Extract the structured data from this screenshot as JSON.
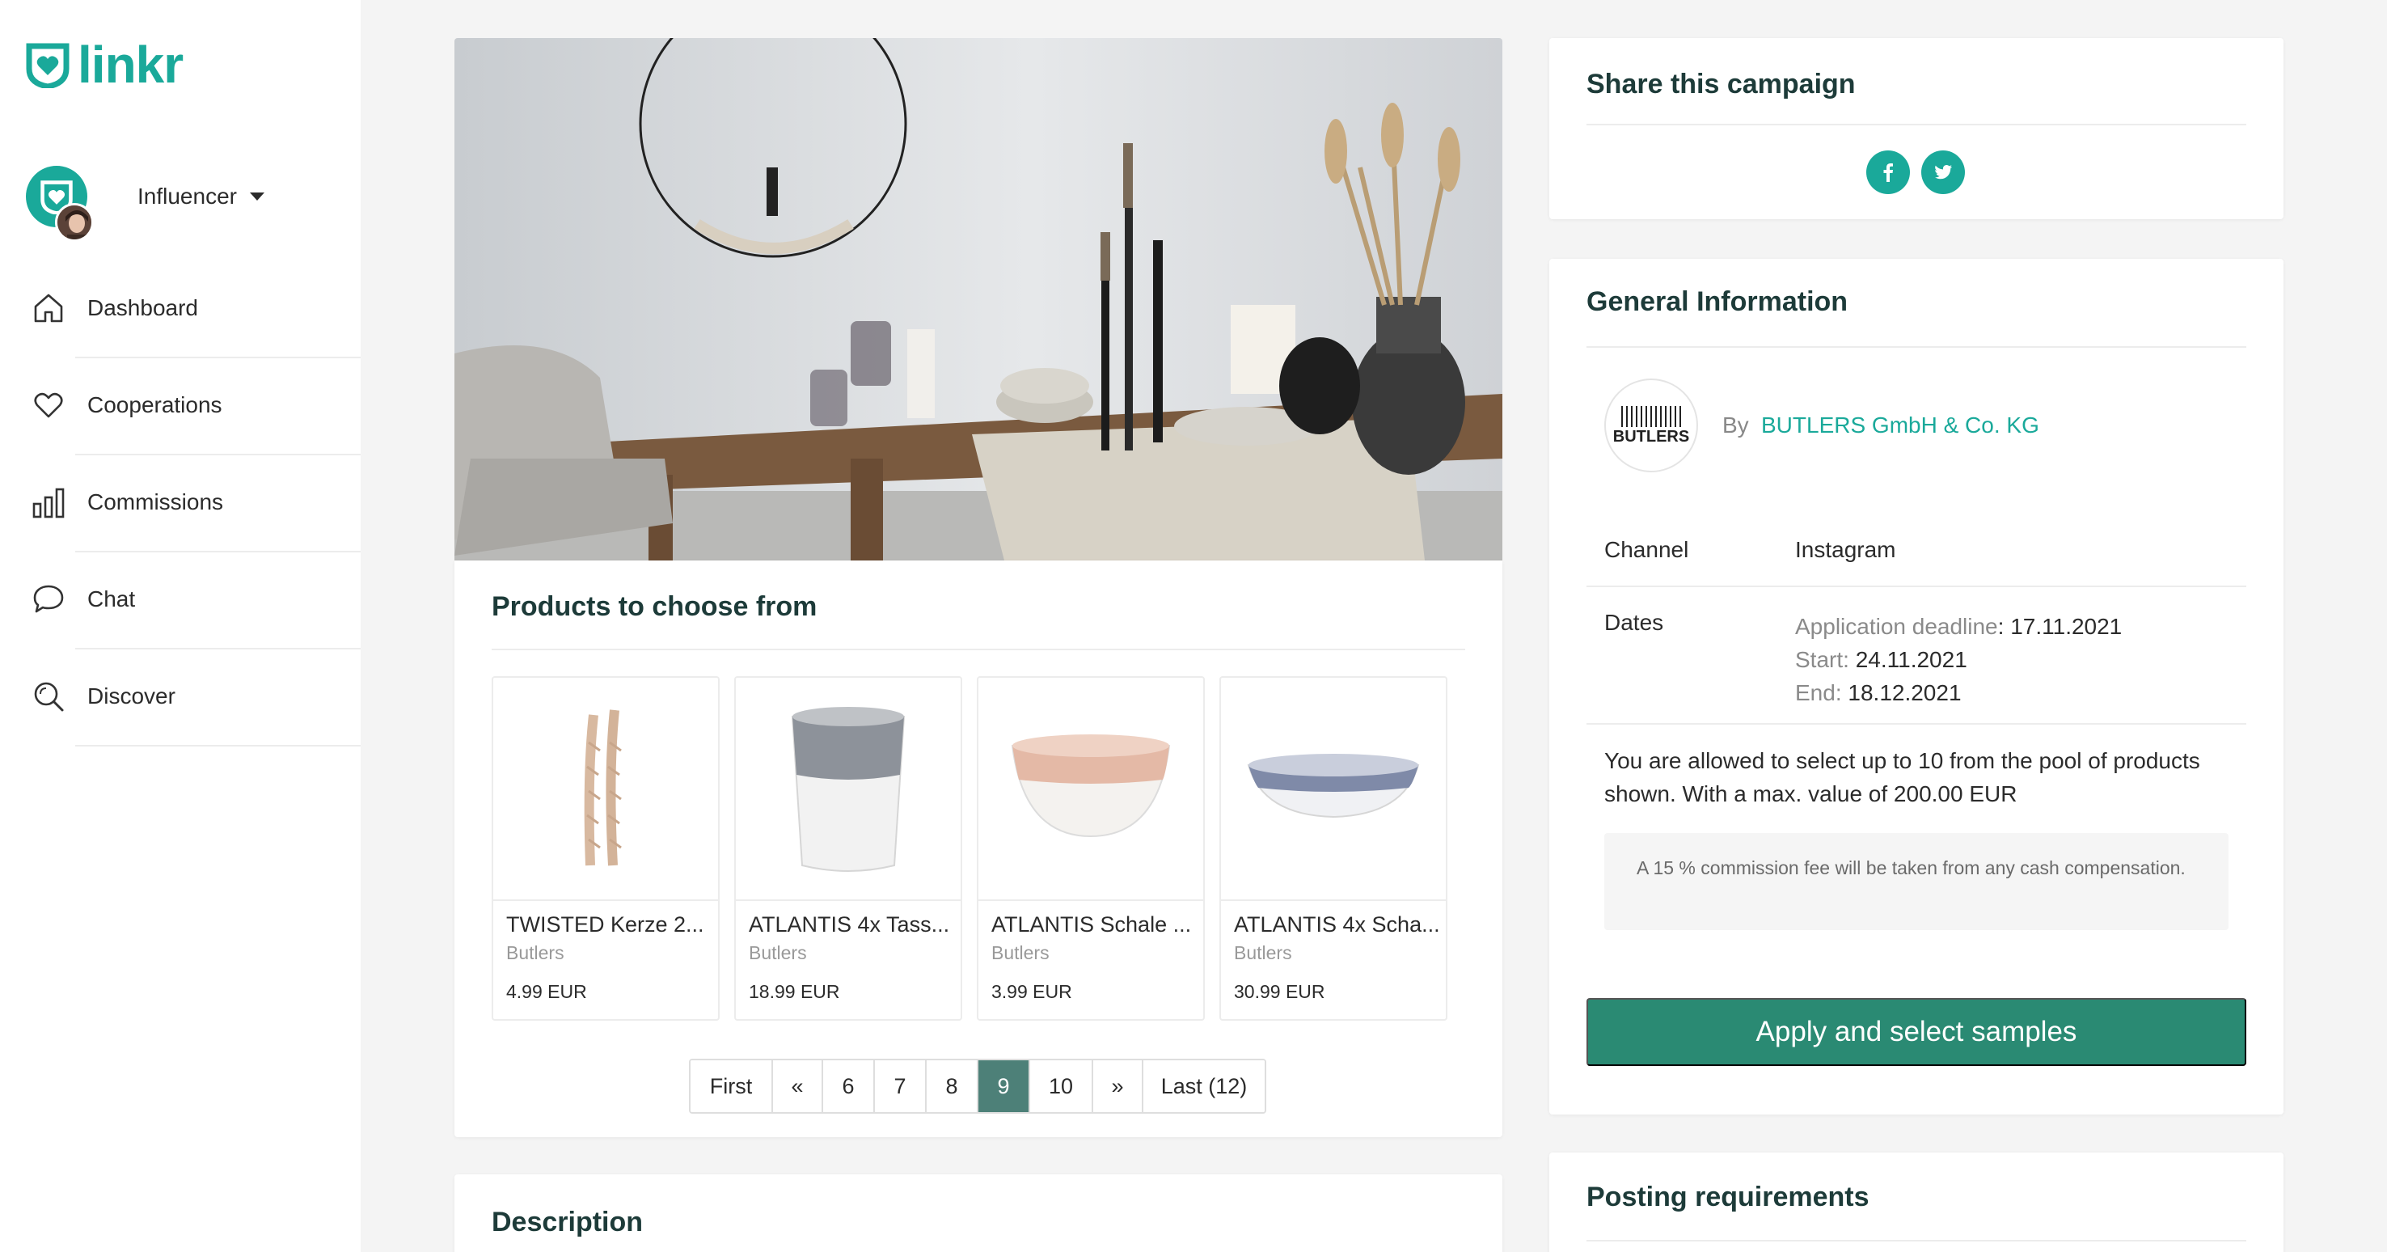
{
  "app": {
    "logo_text": "linkr"
  },
  "user": {
    "role": "Influencer"
  },
  "nav": [
    {
      "label": "Dashboard",
      "icon": "home-icon"
    },
    {
      "label": "Cooperations",
      "icon": "heart-icon"
    },
    {
      "label": "Commissions",
      "icon": "bar-chart-icon"
    },
    {
      "label": "Chat",
      "icon": "chat-bubble-icon"
    },
    {
      "label": "Discover",
      "icon": "search-icon"
    }
  ],
  "products_section": {
    "title": "Products to choose from",
    "items": [
      {
        "name": "TWISTED Kerze 2...",
        "brand": "Butlers",
        "price": "4.99 EUR"
      },
      {
        "name": "ATLANTIS 4x Tass...",
        "brand": "Butlers",
        "price": "18.99 EUR"
      },
      {
        "name": "ATLANTIS Schale ...",
        "brand": "Butlers",
        "price": "3.99 EUR"
      },
      {
        "name": "ATLANTIS 4x Scha...",
        "brand": "Butlers",
        "price": "30.99 EUR"
      }
    ],
    "pagination": {
      "first": "First",
      "prev": "«",
      "pages": [
        "6",
        "7",
        "8",
        "9",
        "10"
      ],
      "active": "9",
      "next": "»",
      "last": "Last (12)"
    }
  },
  "description": {
    "title": "Description"
  },
  "share": {
    "title": "Share this campaign",
    "networks": [
      "facebook-icon",
      "twitter-icon"
    ]
  },
  "general": {
    "title": "General Information",
    "by_label": "By",
    "company": "BUTLERS GmbH & Co. KG",
    "company_logo_text": "BUTLERS",
    "channel_label": "Channel",
    "channel_value": "Instagram",
    "dates_label": "Dates",
    "application_label": "Application deadline",
    "application_value": ": 17.11.2021",
    "start_label": "Start:",
    "start_value": "24.11.2021",
    "end_label": "End:",
    "end_value": "18.12.2021",
    "allowance": "You are allowed to select up to 10 from the pool of products shown. With a max. value of 200.00 EUR",
    "commission_note": "A 15 % commission fee will be taken from any cash compensation.",
    "apply_button": "Apply and select samples"
  },
  "posting": {
    "title": "Posting requirements"
  },
  "colors": {
    "brand": "#1aa99a",
    "button": "#2a8a73",
    "active_page": "#4d8078"
  }
}
